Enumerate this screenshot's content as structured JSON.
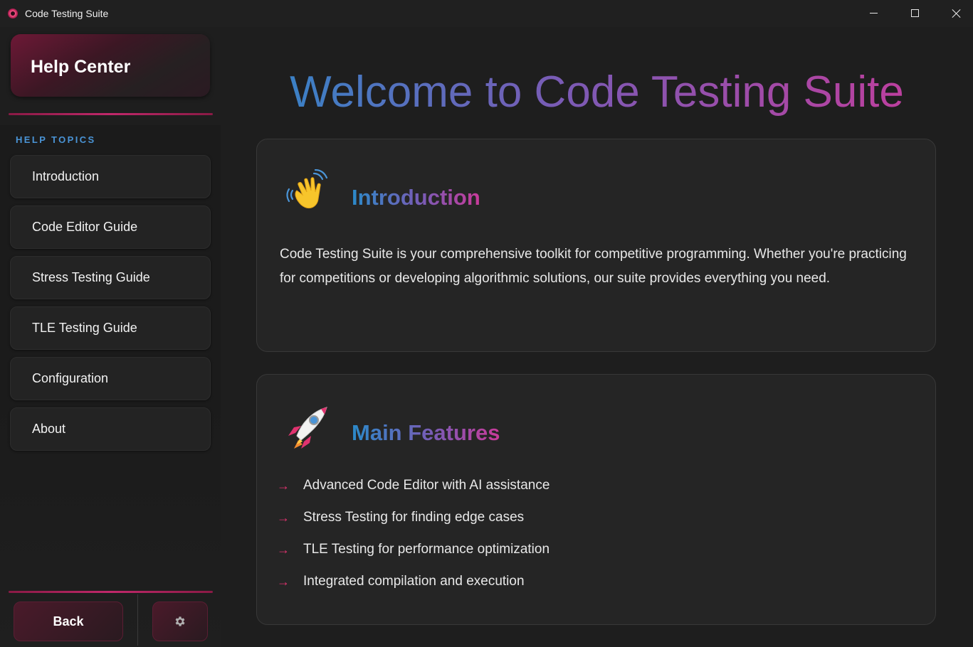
{
  "window": {
    "title": "Code Testing Suite"
  },
  "sidebar": {
    "header": "Help Center",
    "section_label": "HELP TOPICS",
    "items": [
      {
        "label": "Introduction"
      },
      {
        "label": "Code Editor Guide"
      },
      {
        "label": "Stress Testing Guide"
      },
      {
        "label": "TLE Testing Guide"
      },
      {
        "label": "Configuration"
      },
      {
        "label": "About"
      }
    ],
    "back_label": "Back",
    "settings_icon": "gear-icon"
  },
  "main": {
    "heading": "Welcome to Code Testing Suite",
    "intro": {
      "icon": "waving-hand-icon",
      "title": "Introduction",
      "body": "Code Testing Suite is your comprehensive toolkit for competitive programming. Whether you're practicing for competitions or developing algorithmic solutions, our suite provides everything you need."
    },
    "features": {
      "icon": "rocket-icon",
      "title": "Main Features",
      "items": [
        "Advanced Code Editor with AI assistance",
        "Stress Testing for finding edge cases",
        "TLE Testing for performance optimization",
        "Integrated compilation and execution"
      ],
      "bullet": "→"
    }
  },
  "colors": {
    "accent": "#c0286a",
    "topic_label": "#4a94d6",
    "gradient_start": "#2b8ac9",
    "gradient_end": "#c93a9a",
    "bullet": "#e0336f"
  }
}
